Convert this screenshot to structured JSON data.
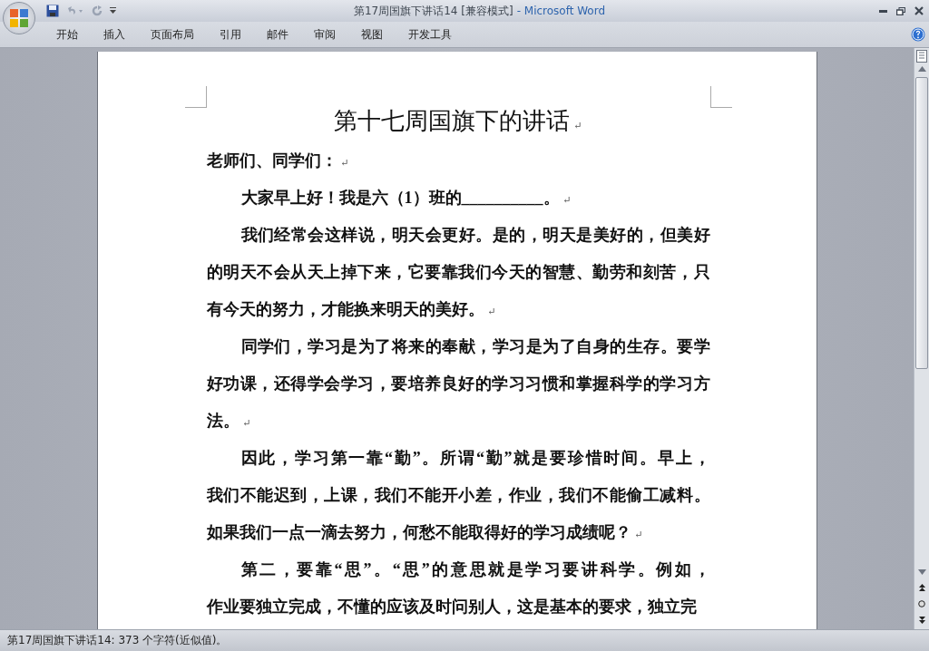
{
  "window": {
    "title": "第17周国旗下讲话14 [兼容模式]",
    "app_name": "- Microsoft Word"
  },
  "ribbon_tabs": [
    {
      "label": "开始",
      "selected": false
    },
    {
      "label": "插入",
      "selected": false
    },
    {
      "label": "页面布局",
      "selected": false
    },
    {
      "label": "引用",
      "selected": false
    },
    {
      "label": "邮件",
      "selected": false
    },
    {
      "label": "审阅",
      "selected": false
    },
    {
      "label": "视图",
      "selected": false
    },
    {
      "label": "开发工具",
      "selected": false
    }
  ],
  "document": {
    "title": "第十七周国旗下的讲话",
    "title_mark": "↵",
    "paragraphs": [
      {
        "kind": "salutation",
        "lines": [
          "老师们、同学们："
        ],
        "mark": "↵"
      },
      {
        "kind": "body",
        "lines": [
          "大家早上好！我是六（1）班的__________。"
        ],
        "mark": "↵"
      },
      {
        "kind": "body",
        "lines": [
          "我们经常会这样说，明天会更好。是的，明天是美好的，但美好",
          "的明天不会从天上掉下来，它要靠我们今天的智慧、勤劳和刻苦，只",
          "有今天的努力，才能换来明天的美好。"
        ],
        "mark": "↵"
      },
      {
        "kind": "body",
        "lines": [
          "同学们，学习是为了将来的奉献，学习是为了自身的生存。要学",
          "好功课，还得学会学习，要培养良好的学习习惯和掌握科学的学习方",
          "法。"
        ],
        "mark": "↵"
      },
      {
        "kind": "body",
        "lines": [
          "因此，学习第一靠“勤”。所谓“勤”就是要珍惜时间。早上，",
          "我们不能迟到，上课，我们不能开小差，作业，我们不能偷工减料。",
          "如果我们一点一滴去努力，何愁不能取得好的学习成绩呢？"
        ],
        "mark": "↵"
      },
      {
        "kind": "body",
        "lines": [
          "第二，要靠“思”。“思”的意思就是学习要讲科学。例如，",
          "作业要独立完成，不懂的应该及时问别人，这是基本的要求，独立完"
        ]
      }
    ]
  },
  "status_bar": {
    "text": "第17周国旗下讲话14: 373 个字符(近似值)。"
  }
}
